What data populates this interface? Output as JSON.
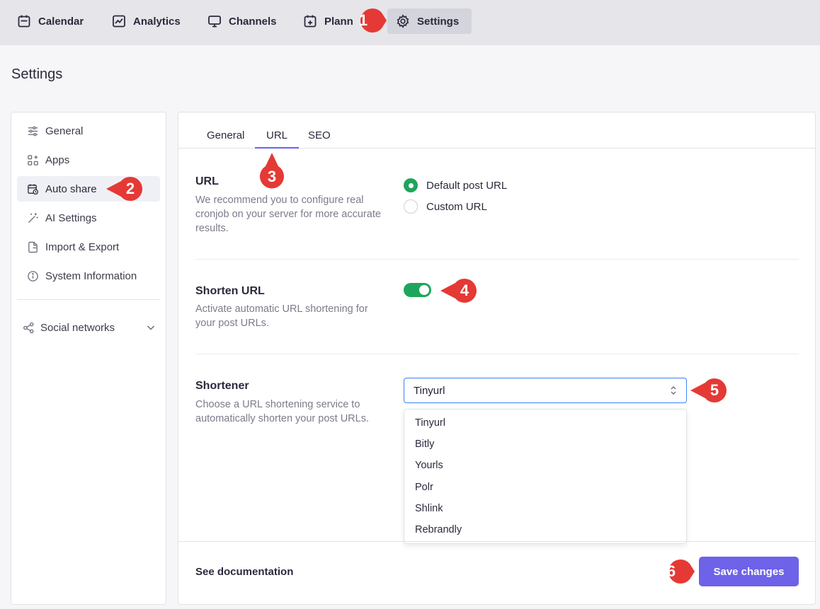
{
  "nav": {
    "items": [
      {
        "label": "Calendar",
        "icon": "calendar-icon"
      },
      {
        "label": "Analytics",
        "icon": "analytics-icon"
      },
      {
        "label": "Channels",
        "icon": "monitor-icon"
      },
      {
        "label": "Plann",
        "icon": "planner-icon"
      },
      {
        "label": "Settings",
        "icon": "gear-icon",
        "active": true
      }
    ]
  },
  "page": {
    "title": "Settings"
  },
  "sidebar": {
    "items": [
      {
        "label": "General",
        "icon": "sliders-icon"
      },
      {
        "label": "Apps",
        "icon": "apps-icon"
      },
      {
        "label": "Auto share",
        "icon": "calendar-clock-icon",
        "active": true
      },
      {
        "label": "AI Settings",
        "icon": "magic-wand-icon"
      },
      {
        "label": "Import & Export",
        "icon": "file-export-icon"
      },
      {
        "label": "System Information",
        "icon": "info-icon"
      }
    ],
    "social": {
      "label": "Social networks",
      "icon": "share-icon"
    }
  },
  "tabs": [
    {
      "label": "General"
    },
    {
      "label": "URL",
      "active": true
    },
    {
      "label": "SEO"
    }
  ],
  "url_section": {
    "title": "URL",
    "description": "We recommend you to configure real cronjob on your server for more accurate results.",
    "options": [
      {
        "label": "Default post URL",
        "checked": true
      },
      {
        "label": "Custom URL",
        "checked": false
      }
    ]
  },
  "shorten_section": {
    "title": "Shorten URL",
    "description": "Activate automatic URL shortening for your post URLs.",
    "enabled": true
  },
  "shortener_section": {
    "title": "Shortener",
    "description": "Choose a URL shortening service to automatically shorten your post URLs.",
    "selected": "Tinyurl",
    "options": [
      "Tinyurl",
      "Bitly",
      "Yourls",
      "Polr",
      "Shlink",
      "Rebrandly"
    ]
  },
  "footer": {
    "doc_link": "See documentation",
    "save_label": "Save changes"
  },
  "callouts": [
    "1",
    "2",
    "3",
    "4",
    "5",
    "6"
  ],
  "colors": {
    "accent": "#6d62e8",
    "success": "#1ea55b",
    "callout": "#e53935",
    "focus": "#3b82f6"
  }
}
